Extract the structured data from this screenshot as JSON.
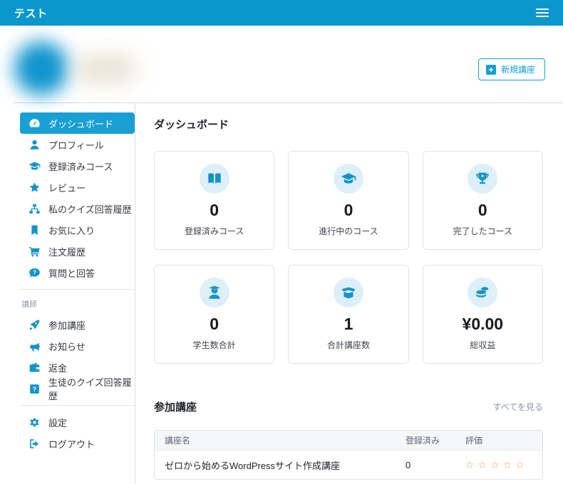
{
  "topbar": {
    "title": "テスト",
    "menu_icon": "hamburger-icon"
  },
  "header": {
    "new_course_label": "新規講座",
    "plus_icon": "plus-icon"
  },
  "sidebar": {
    "items": [
      {
        "label": "ダッシュボード",
        "icon": "dashboard-icon",
        "active": true
      },
      {
        "label": "プロフィール",
        "icon": "user-icon",
        "active": false
      },
      {
        "label": "登録済みコース",
        "icon": "graduation-cap-icon",
        "active": false
      },
      {
        "label": "レビュー",
        "icon": "star-icon",
        "active": false
      },
      {
        "label": "私のクイズ回答履歴",
        "icon": "sitemap-icon",
        "active": false
      },
      {
        "label": "お気に入り",
        "icon": "bookmark-icon",
        "active": false
      },
      {
        "label": "注文履歴",
        "icon": "cart-icon",
        "active": false
      },
      {
        "label": "質問と回答",
        "icon": "question-comment-icon",
        "active": false
      }
    ],
    "section_label": "講師",
    "instructor_items": [
      {
        "label": "参加講座",
        "icon": "rocket-icon",
        "active": false
      },
      {
        "label": "お知らせ",
        "icon": "bullhorn-icon",
        "active": false
      },
      {
        "label": "返金",
        "icon": "wallet-icon",
        "active": false
      },
      {
        "label": "生徒のクイズ回答履歴",
        "icon": "question-square-icon",
        "active": false
      }
    ],
    "footer_items": [
      {
        "label": "設定",
        "icon": "gear-icon",
        "active": false
      },
      {
        "label": "ログアウト",
        "icon": "sign-out-icon",
        "active": false
      }
    ]
  },
  "main": {
    "title": "ダッシュボード",
    "stat_cards": [
      {
        "value": "0",
        "label": "登録済みコース",
        "icon": "book-open-icon"
      },
      {
        "value": "0",
        "label": "進行中のコース",
        "icon": "graduation-cap-icon"
      },
      {
        "value": "0",
        "label": "完了したコース",
        "icon": "trophy-icon"
      },
      {
        "value": "0",
        "label": "学生数合計",
        "icon": "user-graduate-icon"
      },
      {
        "value": "1",
        "label": "合計講座数",
        "icon": "box-open-icon"
      },
      {
        "value": "¥0.00",
        "label": "総収益",
        "icon": "coins-icon"
      }
    ],
    "courses_section": {
      "title": "参加講座",
      "view_all_label": "すべてを見る",
      "table": {
        "headers": [
          "講座名",
          "登録済み",
          "評価"
        ],
        "rows": [
          {
            "name": "ゼロから始めるWordPressサイト作成講座",
            "enrolled": "0",
            "rating": 0,
            "rating_max": 5,
            "stars_display": "☆☆☆☆☆"
          }
        ]
      }
    }
  },
  "colors": {
    "primary": "#0b97cd",
    "active_item_bg": "#18a0d5",
    "icon_blue": "#1294cb",
    "icon_circle_bg": "#ddeff9",
    "star_orange": "#efa832",
    "border": "#dfe3e8"
  }
}
